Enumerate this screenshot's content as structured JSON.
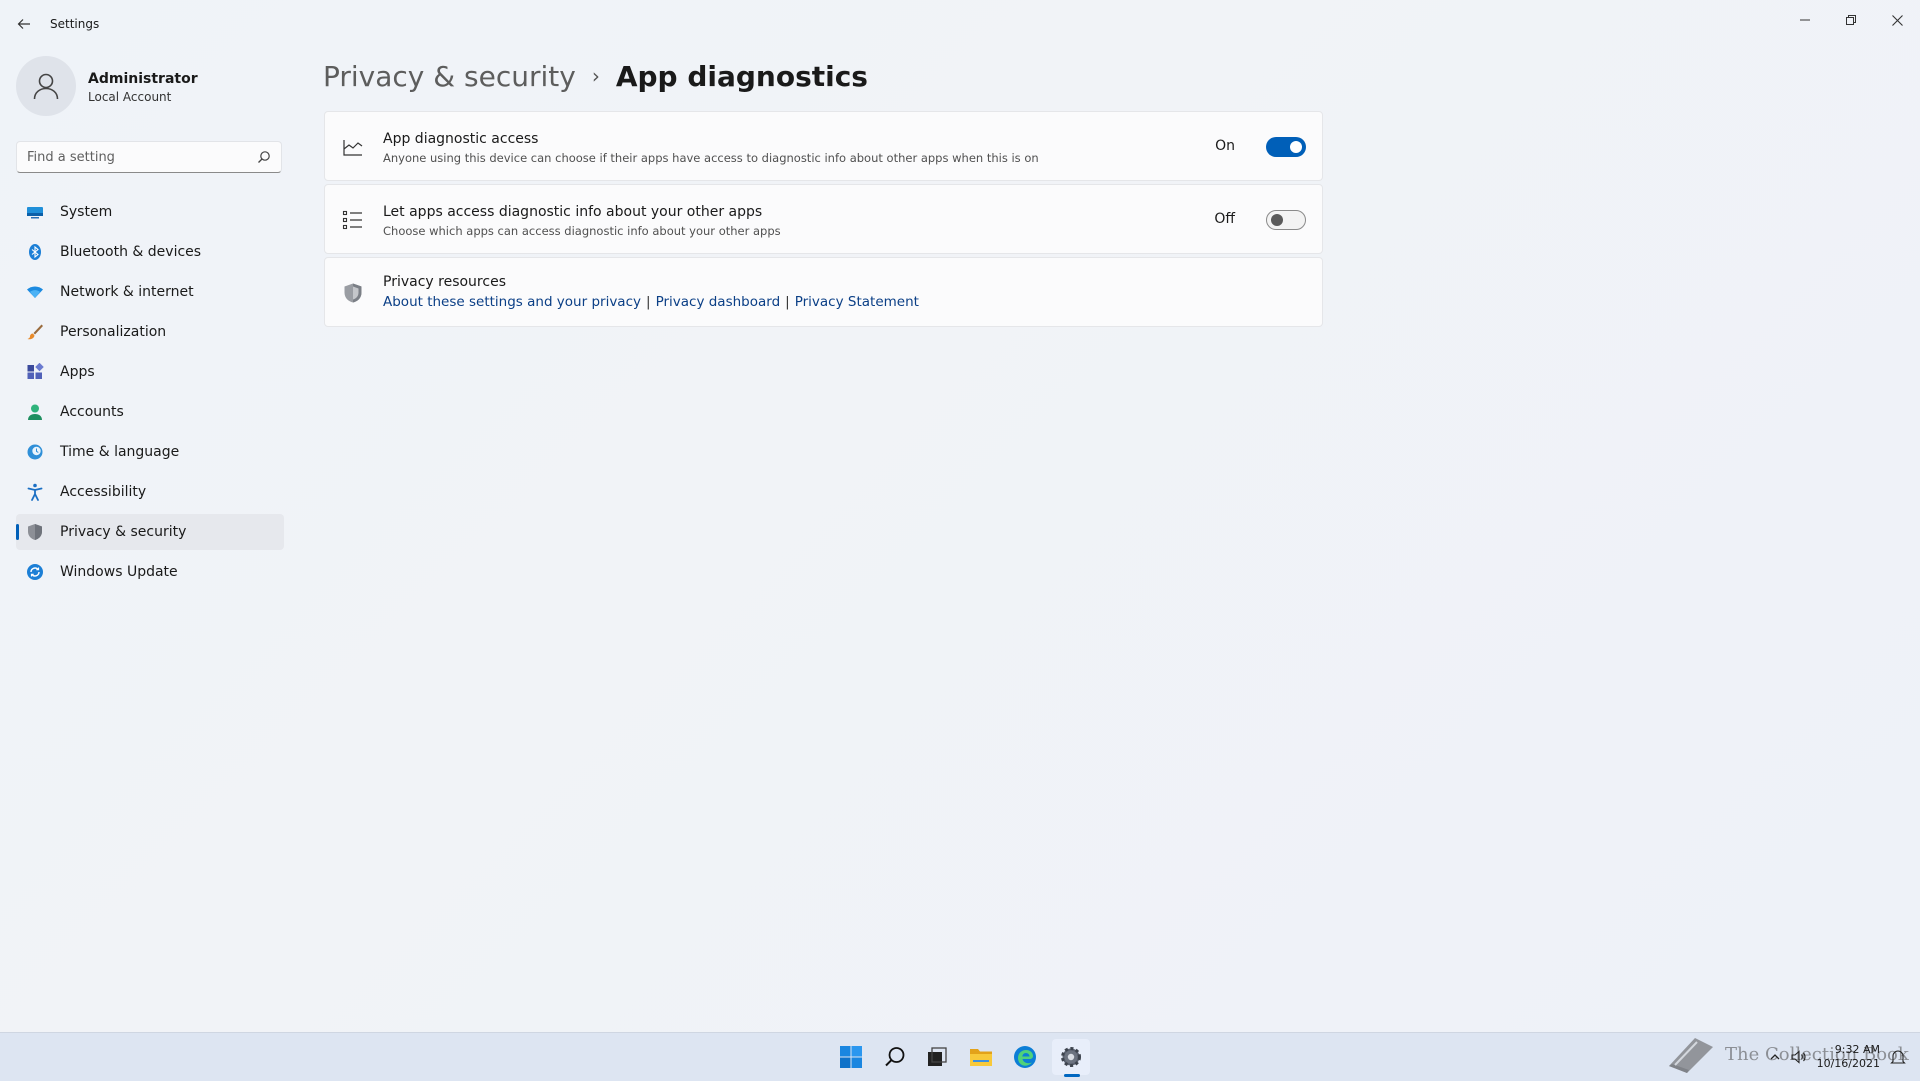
{
  "window": {
    "title": "Settings"
  },
  "profile": {
    "name": "Administrator",
    "account_type": "Local Account"
  },
  "search": {
    "placeholder": "Find a setting",
    "value": ""
  },
  "sidebar": {
    "items": [
      {
        "label": "System",
        "icon": "system-icon",
        "active": false
      },
      {
        "label": "Bluetooth & devices",
        "icon": "bluetooth-icon",
        "active": false
      },
      {
        "label": "Network & internet",
        "icon": "wifi-icon",
        "active": false
      },
      {
        "label": "Personalization",
        "icon": "brush-icon",
        "active": false
      },
      {
        "label": "Apps",
        "icon": "apps-icon",
        "active": false
      },
      {
        "label": "Accounts",
        "icon": "person-icon",
        "active": false
      },
      {
        "label": "Time & language",
        "icon": "clock-globe-icon",
        "active": false
      },
      {
        "label": "Accessibility",
        "icon": "accessibility-icon",
        "active": false
      },
      {
        "label": "Privacy & security",
        "icon": "shield-icon",
        "active": true
      },
      {
        "label": "Windows Update",
        "icon": "update-icon",
        "active": false
      }
    ]
  },
  "breadcrumb": {
    "parent": "Privacy & security",
    "separator": "›",
    "current": "App diagnostics"
  },
  "settings": {
    "app_diagnostic_access": {
      "title": "App diagnostic access",
      "description": "Anyone using this device can choose if their apps have access to diagnostic info about other apps when this is on",
      "state_label": "On",
      "enabled": true,
      "icon": "diagnostics-chart-icon"
    },
    "let_apps_access": {
      "title": "Let apps access diagnostic info about your other apps",
      "description": "Choose which apps can access diagnostic info about your other apps",
      "state_label": "Off",
      "enabled": false,
      "icon": "list-icon"
    }
  },
  "privacy_resources": {
    "title": "Privacy resources",
    "icon": "shield-icon",
    "links": [
      "About these settings and your privacy",
      "Privacy dashboard",
      "Privacy Statement"
    ],
    "separator": "|"
  },
  "taskbar": {
    "apps": [
      "start-icon",
      "search-icon",
      "task-view-icon",
      "file-explorer-icon",
      "edge-icon",
      "settings-gear-icon"
    ],
    "active_app": "settings-gear-icon"
  },
  "tray": {
    "time": "9:32 AM",
    "date": "10/16/2021"
  },
  "watermark": {
    "text": "The Collection Book"
  },
  "colors": {
    "accent": "#005fb8",
    "link": "#0b3f86",
    "background": "#eff3f8"
  }
}
